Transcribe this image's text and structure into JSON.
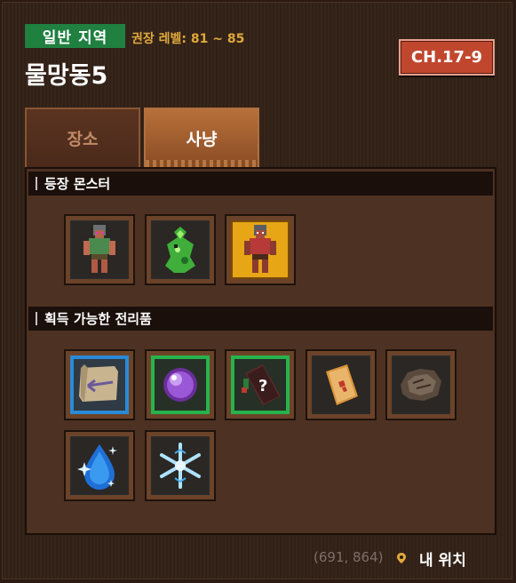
{
  "header": {
    "zone_type": "일반 지역",
    "recommended_level": "권장 레벨: 81 ~ 85",
    "title": "물망동5",
    "chapter": "CH.17-9"
  },
  "tabs": [
    {
      "label": "장소",
      "active": false
    },
    {
      "label": "사냥",
      "active": true
    }
  ],
  "monsters": {
    "heading": "등장 몬스터",
    "items": [
      {
        "icon": "green-orc-warrior-icon",
        "frame": "normal"
      },
      {
        "icon": "green-slime-creature-icon",
        "frame": "normal"
      },
      {
        "icon": "red-orc-warrior-icon",
        "frame": "gold"
      }
    ]
  },
  "loot": {
    "heading": "획득 가능한 전리품",
    "items": [
      {
        "icon": "scroll-map-icon",
        "rarity": "blue"
      },
      {
        "icon": "purple-orb-icon",
        "rarity": "green"
      },
      {
        "icon": "mystery-book-icon",
        "rarity": "green"
      },
      {
        "icon": "red-envelope-card-icon",
        "rarity": "normal"
      },
      {
        "icon": "fur-pelt-icon",
        "rarity": "normal"
      },
      {
        "icon": "blue-water-drop-icon",
        "rarity": "normal"
      },
      {
        "icon": "ice-snowflake-icon",
        "rarity": "normal"
      }
    ]
  },
  "footer": {
    "coordinates": "(691, 864)",
    "my_location_label": "내 위치"
  },
  "colors": {
    "zone_badge": "#1f8040",
    "chapter_badge": "#c0472e",
    "level_text": "#e0a93c",
    "rarity_blue": "#2a8ad6",
    "rarity_green": "#27b34b",
    "frame_gold": "#e6a616"
  }
}
